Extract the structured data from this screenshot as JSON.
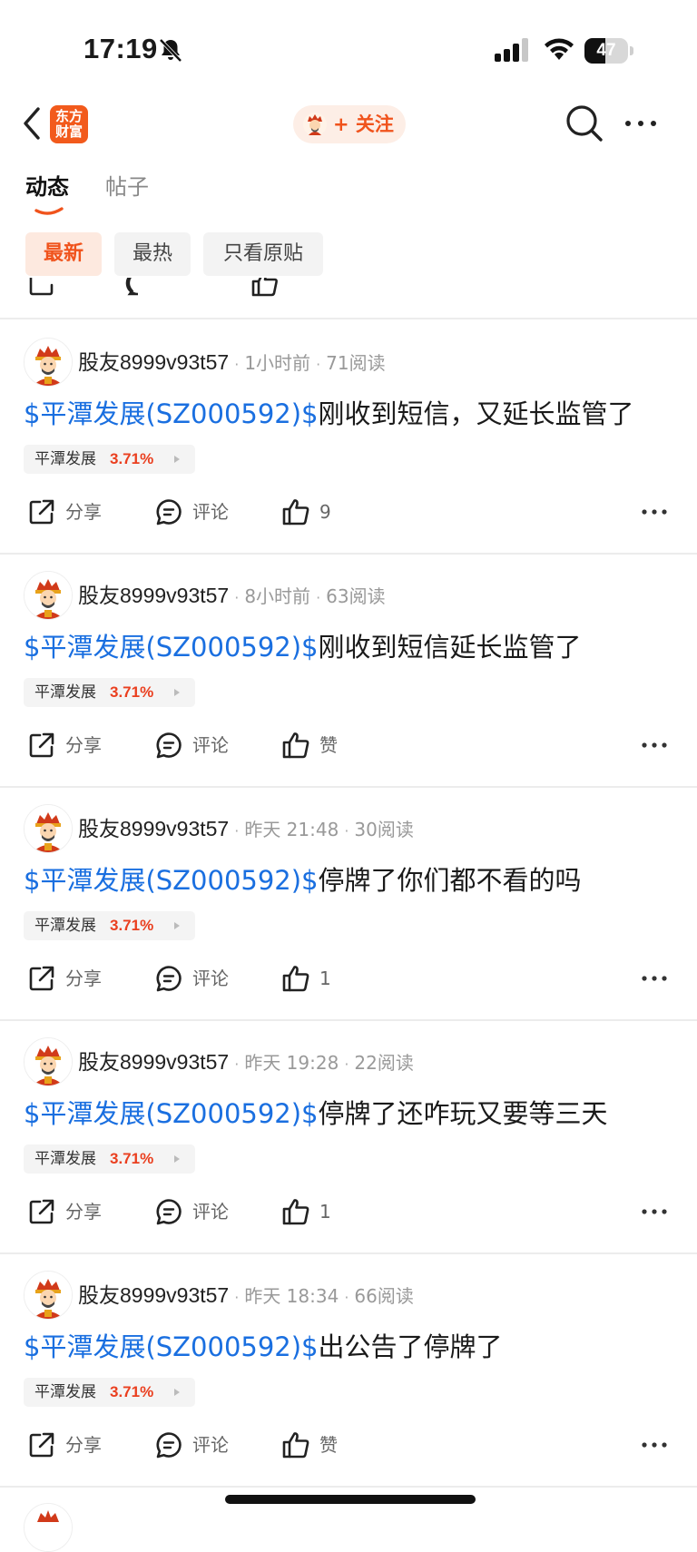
{
  "status_bar": {
    "time": "17:19",
    "battery": "47",
    "battery_level": 0.47
  },
  "nav": {
    "logo_text": "东方\n财富",
    "follow_label": "+ 关注"
  },
  "tabs": [
    {
      "label": "动态",
      "active": true
    },
    {
      "label": "帖子",
      "active": false
    }
  ],
  "filters": [
    {
      "label": "最新",
      "active": true
    },
    {
      "label": "最热",
      "active": false
    },
    {
      "label": "只看原贴",
      "active": false
    }
  ],
  "colors": {
    "accent": "#f0531c",
    "link": "#1a6fe0",
    "up": "#ea3f1f"
  },
  "actions": {
    "share": "分享",
    "comment": "评论"
  },
  "posts": [
    {
      "user": "股友8999v93t57",
      "time": "1小时前",
      "reads": "71阅读",
      "tag": "$平潭发展(SZ000592)$",
      "text": "刚收到短信，又延长监管了",
      "stock_name": "平潭发展",
      "stock_change": "3.71%",
      "likes": "9"
    },
    {
      "user": "股友8999v93t57",
      "time": "8小时前",
      "reads": "63阅读",
      "tag": "$平潭发展(SZ000592)$",
      "text": "刚收到短信延长监管了",
      "stock_name": "平潭发展",
      "stock_change": "3.71%",
      "likes": "赞"
    },
    {
      "user": "股友8999v93t57",
      "time": "昨天 21:48",
      "reads": "30阅读",
      "tag": "$平潭发展(SZ000592)$",
      "text": "停牌了你们都不看的吗",
      "stock_name": "平潭发展",
      "stock_change": "3.71%",
      "likes": "1"
    },
    {
      "user": "股友8999v93t57",
      "time": "昨天 19:28",
      "reads": "22阅读",
      "tag": "$平潭发展(SZ000592)$",
      "text": "停牌了还咋玩又要等三天",
      "stock_name": "平潭发展",
      "stock_change": "3.71%",
      "likes": "1"
    },
    {
      "user": "股友8999v93t57",
      "time": "昨天 18:34",
      "reads": "66阅读",
      "tag": "$平潭发展(SZ000592)$",
      "text": "出公告了停牌了",
      "stock_name": "平潭发展",
      "stock_change": "3.71%",
      "likes": "赞"
    }
  ]
}
